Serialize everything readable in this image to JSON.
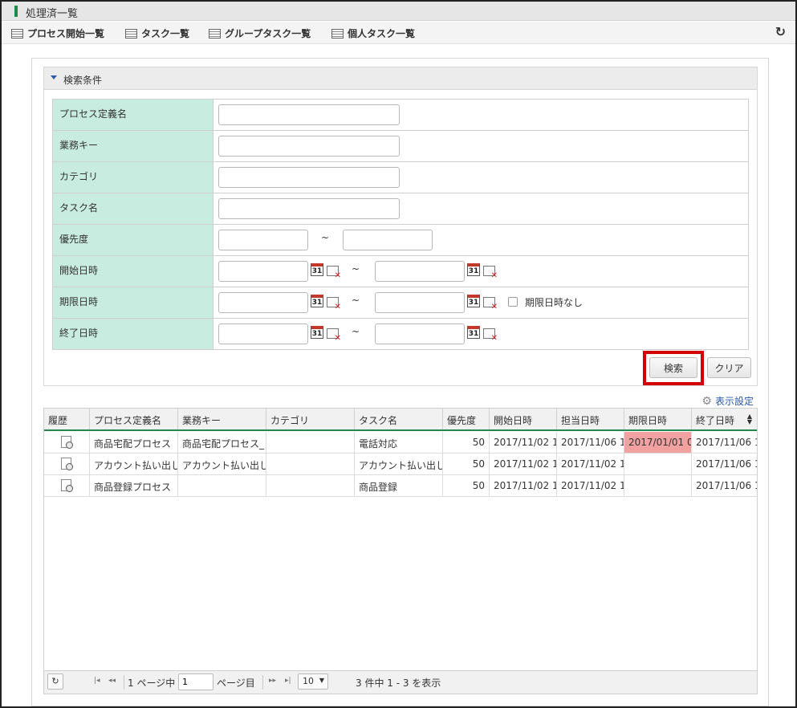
{
  "window": {
    "title": "処理済一覧"
  },
  "nav": {
    "items": [
      {
        "label": "プロセス開始一覧"
      },
      {
        "label": "タスク一覧"
      },
      {
        "label": "グループタスク一覧"
      },
      {
        "label": "個人タスク一覧"
      }
    ]
  },
  "search": {
    "header": "検索条件",
    "fields": {
      "process_def_name": {
        "label": "プロセス定義名",
        "value": ""
      },
      "business_key": {
        "label": "業務キー",
        "value": ""
      },
      "category": {
        "label": "カテゴリ",
        "value": ""
      },
      "task_name": {
        "label": "タスク名",
        "value": ""
      },
      "priority": {
        "label": "優先度",
        "from": "",
        "to": ""
      },
      "start_datetime": {
        "label": "開始日時",
        "from": "",
        "to": ""
      },
      "due_datetime": {
        "label": "期限日時",
        "from": "",
        "to": "",
        "no_due_label": "期限日時なし",
        "no_due_checked": false
      },
      "end_datetime": {
        "label": "終了日時",
        "from": "",
        "to": ""
      }
    },
    "range_separator": "~",
    "calendar_icon_text": "31",
    "search_button": "検索",
    "clear_button": "クリア"
  },
  "display_settings_label": "表示設定",
  "grid": {
    "columns": [
      "履歴",
      "プロセス定義名",
      "業務キー",
      "カテゴリ",
      "タスク名",
      "優先度",
      "開始日時",
      "担当日時",
      "期限日時",
      "終了日時"
    ],
    "rows": [
      {
        "process_def_name": "商品宅配プロセス",
        "business_key": "商品宅配プロセス_",
        "category": "",
        "task_name": "電話対応",
        "priority": "50",
        "start": "2017/11/02 1",
        "assigned": "2017/11/06 1",
        "due": "2017/01/01 0",
        "end": "2017/11/06 1",
        "due_highlight": true
      },
      {
        "process_def_name": "アカウント払い出し",
        "business_key": "アカウント払い出し",
        "category": "",
        "task_name": "アカウント払い出し",
        "priority": "50",
        "start": "2017/11/02 1",
        "assigned": "2017/11/02 1",
        "due": "",
        "end": "2017/11/06 1",
        "due_highlight": false
      },
      {
        "process_def_name": "商品登録プロセス",
        "business_key": "",
        "category": "",
        "task_name": "商品登録",
        "priority": "50",
        "start": "2017/11/02 1",
        "assigned": "2017/11/02 1",
        "due": "",
        "end": "2017/11/06 1",
        "due_highlight": false
      }
    ]
  },
  "pager": {
    "page_prefix": "1 ページ中",
    "page_value": "1",
    "page_suffix": "ページ目",
    "page_size": "10",
    "summary": "3 件中 1 - 3 を表示"
  },
  "colors": {
    "label_bg": "#c8ece0",
    "header_accent": "#1f8a4c",
    "due_highlight": "#f2a1a1",
    "link": "#2b5aa8",
    "focus_border": "#d40000"
  }
}
